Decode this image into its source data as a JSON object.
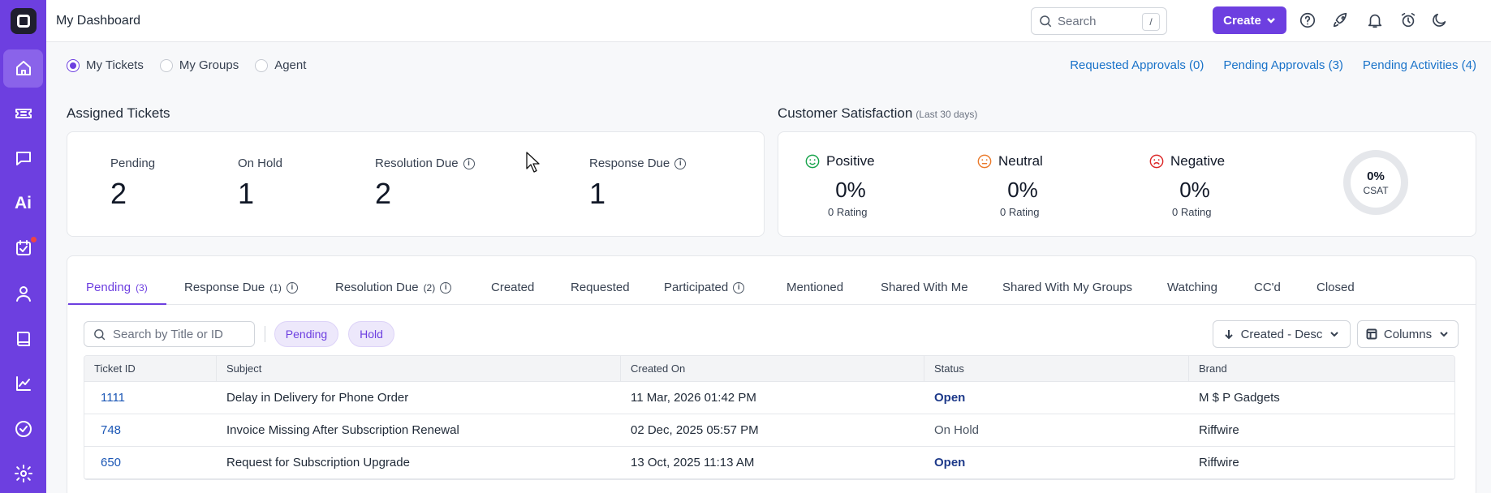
{
  "app": {
    "page_title": "My Dashboard"
  },
  "sidebar": {
    "items": [
      {
        "name": "home",
        "icon": "home-icon",
        "active": true
      },
      {
        "name": "tickets",
        "icon": "ticket-icon"
      },
      {
        "name": "chat",
        "icon": "chat-icon"
      },
      {
        "name": "ai",
        "label": "Ai"
      },
      {
        "name": "tasks",
        "icon": "task-calendar-icon",
        "badge": true
      },
      {
        "name": "contacts",
        "icon": "user-icon"
      },
      {
        "name": "knowledge-base",
        "icon": "book-icon"
      },
      {
        "name": "reports",
        "icon": "chart-icon"
      },
      {
        "name": "approvals",
        "icon": "check-circle-icon"
      },
      {
        "name": "settings",
        "icon": "gear-icon"
      }
    ]
  },
  "header": {
    "search_placeholder": "Search",
    "search_shortcut": "/",
    "create_label": "Create"
  },
  "filters": {
    "options": [
      "My Tickets",
      "My Groups",
      "Agent"
    ],
    "selected": "My Tickets"
  },
  "links": {
    "requested_approvals": "Requested Approvals (0)",
    "pending_approvals": "Pending Approvals (3)",
    "pending_activities": "Pending Activities (4)"
  },
  "assigned": {
    "title": "Assigned Tickets",
    "stats": [
      {
        "label": "Pending",
        "value": "2"
      },
      {
        "label": "On Hold",
        "value": "1"
      },
      {
        "label": "Resolution Due",
        "value": "2"
      },
      {
        "label": "Response Due",
        "value": "1"
      }
    ]
  },
  "satisfaction": {
    "title": "Customer Satisfaction",
    "subtitle": "(Last 30 days)",
    "items": [
      {
        "label": "Positive",
        "pct": "0%",
        "rating": "0 Rating",
        "color": "#16a34a"
      },
      {
        "label": "Neutral",
        "pct": "0%",
        "rating": "0 Rating",
        "color": "#ea7a2b"
      },
      {
        "label": "Negative",
        "pct": "0%",
        "rating": "0 Rating",
        "color": "#dc2626"
      }
    ],
    "csat_pct": "0%",
    "csat_label": "CSAT"
  },
  "tabs": [
    {
      "label": "Pending",
      "count": "(3)"
    },
    {
      "label": "Response Due",
      "count": "(1)"
    },
    {
      "label": "Resolution Due",
      "count": "(2)"
    },
    {
      "label": "Created"
    },
    {
      "label": "Requested"
    },
    {
      "label": "Participated"
    },
    {
      "label": "Mentioned"
    },
    {
      "label": "Shared With Me"
    },
    {
      "label": "Shared With My Groups"
    },
    {
      "label": "Watching"
    },
    {
      "label": "CC'd"
    },
    {
      "label": "Closed"
    }
  ],
  "toolbar": {
    "search_placeholder": "Search by Title or ID",
    "chips": [
      "Pending",
      "Hold"
    ],
    "sort_label": "Created - Desc",
    "columns_label": "Columns"
  },
  "table": {
    "headers": [
      "Ticket ID",
      "Subject",
      "Created On",
      "Status",
      "Brand"
    ],
    "rows": [
      [
        "1111",
        "Delay in Delivery for Phone Order",
        "11 Mar, 2026 01:42 PM",
        "Open",
        "M $ P Gadgets"
      ],
      [
        "748",
        "Invoice Missing After Subscription Renewal",
        "02 Dec, 2025 05:57 PM",
        "On Hold",
        "Riffwire"
      ],
      [
        "650",
        "Request for Subscription Upgrade",
        "13 Oct, 2025 11:13 AM",
        "Open",
        "Riffwire"
      ]
    ]
  },
  "colors": {
    "brand": "#6d3fe0",
    "link": "#1a73c9"
  }
}
